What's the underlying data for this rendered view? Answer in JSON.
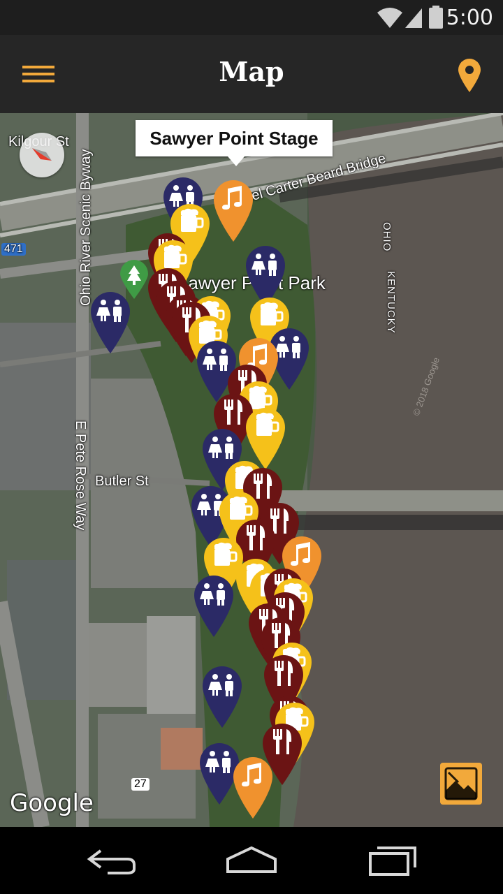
{
  "status_bar": {
    "time": "5:00",
    "icons": [
      "wifi-icon",
      "cellular-icon",
      "battery-icon"
    ]
  },
  "app_bar": {
    "title": "Map",
    "menu_icon": "hamburger-menu-icon",
    "location_icon": "map-pin-icon",
    "accent_color": "#f2a93b"
  },
  "map": {
    "selected_marker_title": "Sawyer Point Stage",
    "labels": {
      "kilgour": "Kilgour St",
      "ohio_byway": "Ohio River Scenic Byway",
      "park": "Sawyer Point Park",
      "bridge": "Daniel Carter Beard Bridge",
      "ohio": "OHIO",
      "kentucky": "KENTUCKY",
      "pete_rose": "E Pete Rose Way",
      "butler": "Butler St",
      "i471": "471",
      "us27": "27",
      "copyright": "© 2018 Google"
    },
    "attribution": "Google",
    "marker_colors": {
      "restroom": "#2b2a66",
      "beer": "#f5c11a",
      "food": "#6b1414",
      "music": "#f0922e",
      "park": "#3f9b45"
    },
    "layers_icon": "image-layers-icon"
  },
  "nav_bar": {
    "icons": [
      "back-icon",
      "home-icon",
      "recents-icon"
    ]
  }
}
